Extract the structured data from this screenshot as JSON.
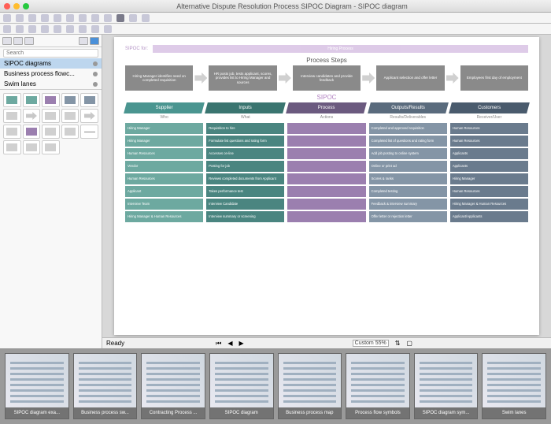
{
  "window": {
    "title": "Alternative Dispute Resolution Process SIPOC Diagram - SIPOC diagram"
  },
  "sidebar": {
    "search_placeholder": "Search",
    "items": [
      {
        "label": "SIPOC diagrams",
        "selected": true
      },
      {
        "label": "Business process flowc...",
        "selected": false
      },
      {
        "label": "Swim lanes",
        "selected": false
      }
    ]
  },
  "diagram": {
    "sipoc_for": "SIPOC for:",
    "banner_text": "Hiring Process",
    "process_steps_title": "Process Steps",
    "sipoc_title": "SIPOC",
    "steps": [
      "Hiring Manager identifies need on completed requisition",
      "HR posts job, tests applicant, scores, provides list to Hiring Manager and sources",
      "Interview candidates and provide feedback",
      "Applicant selection and offer letter",
      "Employees first day of employment"
    ],
    "columns": [
      {
        "header": "Supplier",
        "sub": "Who",
        "class": "c-teal",
        "cells": [
          "Hiring Manager",
          "Hiring Manager",
          "Human Resources",
          "Vendor",
          "Human Resources",
          "Applicant",
          "Interview Team",
          "Hiring Manager & Human Resources"
        ]
      },
      {
        "header": "Inputs",
        "sub": "What",
        "class": "c-darkteal",
        "cells": [
          "Requisition to hire",
          "Formulate list questions and rating form",
          "Accesses on-line",
          "Posting for job",
          "Reviews completed documents from Applicant",
          "Takes performance test",
          "Interview Candidate",
          "Interview summary or screening"
        ]
      },
      {
        "header": "Process",
        "sub": "Actions",
        "class": "c-purple",
        "cells": [
          "",
          "",
          "",
          "",
          "",
          "",
          "",
          ""
        ]
      },
      {
        "header": "Outputs/Results",
        "sub": "Results/Deliverables",
        "class": "c-slate",
        "cells": [
          "Completed and approved requisition",
          "Completed list of questions and rating form",
          "Add job posting to online system",
          "Online or print ad",
          "Scores & ranks",
          "Completed testing",
          "Feedback & interview summary",
          "Offer letter or rejection letter"
        ]
      },
      {
        "header": "Customers",
        "sub": "Receiver/User",
        "class": "c-dkslate",
        "cells": [
          "Human Resources",
          "Human Resources",
          "Applicants",
          "Applicants",
          "Hiring Manager",
          "Human Resources",
          "Hiring Manager & Human Resources",
          "Applicant/Applicants"
        ]
      }
    ]
  },
  "status": {
    "ready": "Ready",
    "zoom": "Custom 55%"
  },
  "gallery": [
    "SIPOC diagram exa...",
    "Business process sw...",
    "Contracting Process ...",
    "SIPOC diagram",
    "Business process map",
    "Process flow symbols",
    "SIPOC diagram sym...",
    "Swim lanes"
  ]
}
